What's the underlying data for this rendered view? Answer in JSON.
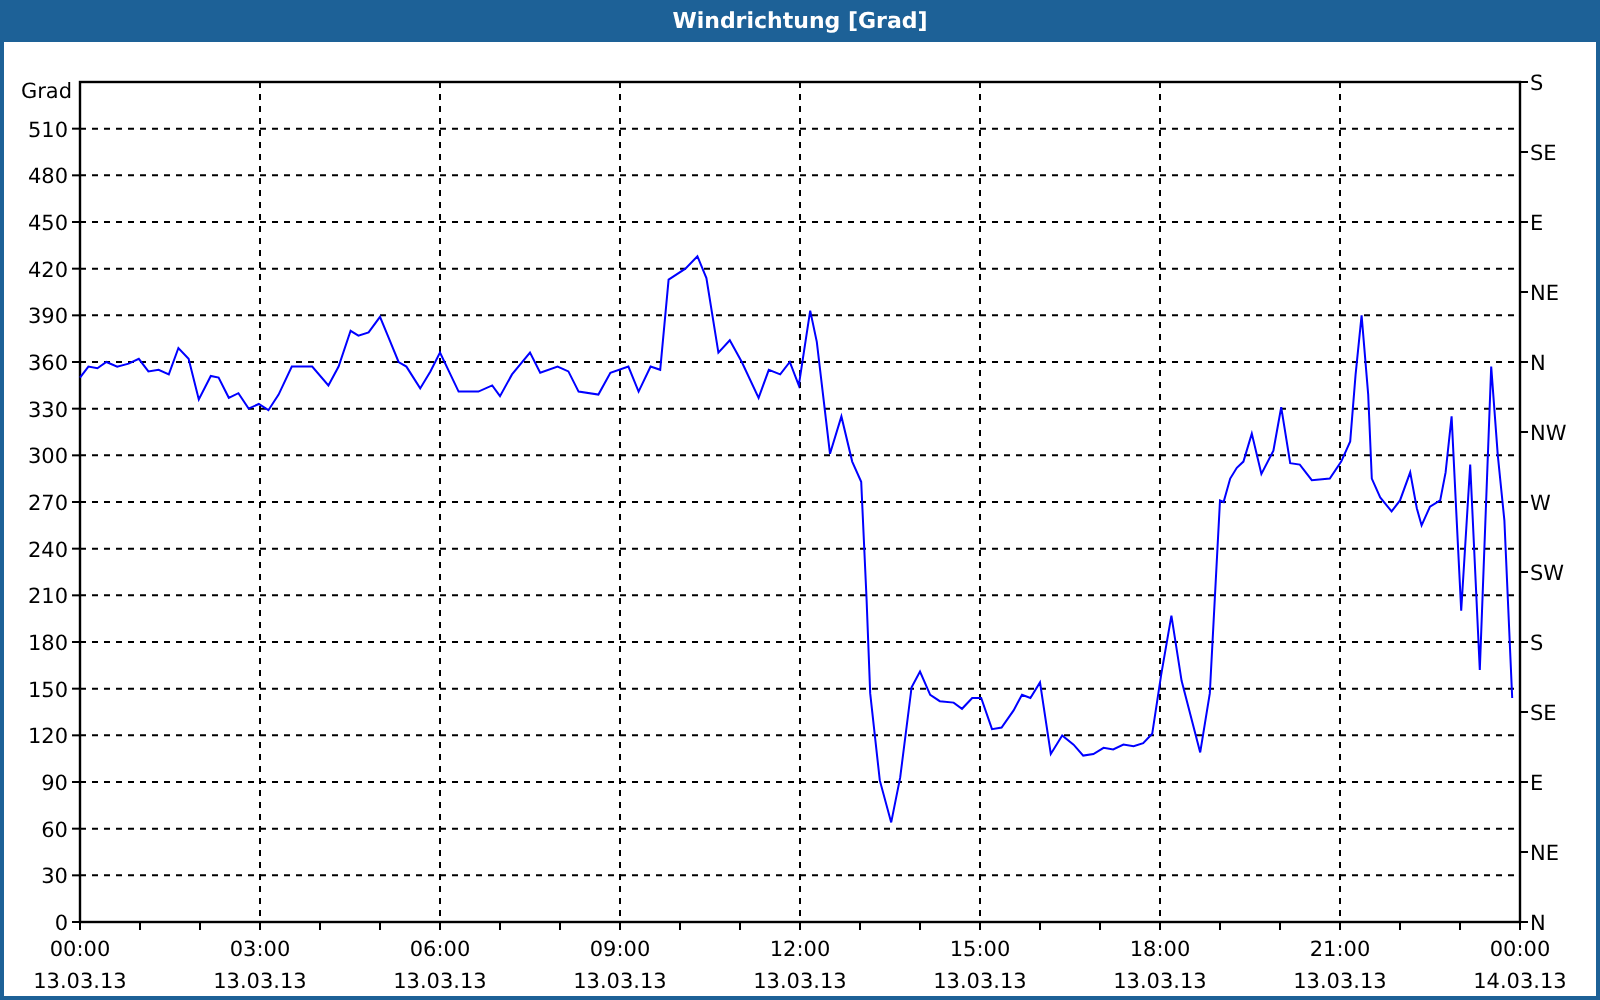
{
  "window": {
    "title": "Windrichtung [Grad]"
  },
  "chart": {
    "x_axis_dates": [
      "13.03.13",
      "13.03.13",
      "13.03.13",
      "13.03.13",
      "13.03.13",
      "13.03.13",
      "13.03.13",
      "13.03.13",
      "14.03.13"
    ],
    "right_axis_labels": [
      "S",
      "SE",
      "E",
      "NE",
      "N",
      "NW",
      "W",
      "SW",
      "S",
      "SE",
      "E",
      "NE",
      "N"
    ],
    "chart_data": {
      "type": "line",
      "grid": true,
      "ylabel": "Grad",
      "xlim": [
        0,
        24
      ],
      "ylim": [
        0,
        540
      ],
      "yticks": [
        0,
        30,
        60,
        90,
        120,
        150,
        180,
        210,
        240,
        270,
        300,
        330,
        360,
        390,
        420,
        450,
        480,
        510
      ],
      "xticks": [
        {
          "value": 0,
          "label": "00:00"
        },
        {
          "value": 3,
          "label": "03:00"
        },
        {
          "value": 6,
          "label": "06:00"
        },
        {
          "value": 9,
          "label": "09:00"
        },
        {
          "value": 12,
          "label": "12:00"
        },
        {
          "value": 15,
          "label": "15:00"
        },
        {
          "value": 18,
          "label": "18:00"
        },
        {
          "value": 21,
          "label": "21:00"
        },
        {
          "value": 24,
          "label": "00:00"
        }
      ],
      "x": [
        0,
        0.14,
        0.29,
        0.44,
        0.62,
        0.81,
        0.98,
        1.14,
        1.31,
        1.48,
        1.64,
        1.81,
        1.98,
        2.18,
        2.31,
        2.48,
        2.64,
        2.81,
        2.98,
        3.14,
        3.31,
        3.53,
        3.87,
        4.14,
        4.31,
        4.51,
        4.64,
        4.81,
        5.0,
        5.14,
        5.31,
        5.44,
        5.67,
        5.84,
        6.0,
        6.31,
        6.64,
        6.87,
        7.0,
        7.2,
        7.5,
        7.67,
        7.96,
        8.14,
        8.31,
        8.64,
        8.84,
        9.14,
        9.31,
        9.51,
        9.67,
        9.81,
        10.09,
        10.29,
        10.44,
        10.64,
        10.83,
        11.03,
        11.31,
        11.48,
        11.67,
        11.83,
        11.98,
        12.17,
        12.28,
        12.5,
        12.69,
        12.87,
        13.02,
        13.11,
        13.17,
        13.33,
        13.52,
        13.67,
        13.86,
        14.0,
        14.17,
        14.33,
        14.56,
        14.7,
        14.87,
        15.02,
        15.2,
        15.36,
        15.56,
        15.7,
        15.84,
        16.0,
        16.18,
        16.37,
        16.56,
        16.72,
        16.89,
        17.06,
        17.22,
        17.39,
        17.56,
        17.72,
        17.87,
        18.02,
        18.19,
        18.36,
        18.67,
        18.83,
        19.0,
        19.06,
        19.17,
        19.28,
        19.39,
        19.53,
        19.69,
        19.89,
        20.02,
        20.17,
        20.33,
        20.53,
        20.83,
        21.02,
        21.17,
        21.26,
        21.36,
        21.47,
        21.53,
        21.67,
        21.86,
        22.0,
        22.17,
        22.28,
        22.36,
        22.5,
        22.67,
        22.76,
        22.86,
        22.94,
        23.02,
        23.17,
        23.33,
        23.52,
        23.63,
        23.74,
        23.87
      ],
      "series": [
        {
          "color": "#0000ff",
          "values": [
            350,
            357,
            356,
            360,
            357,
            359,
            362,
            354,
            355,
            352,
            369,
            362,
            336,
            351,
            350,
            337,
            340,
            330,
            333,
            329,
            339,
            357,
            357,
            345,
            357,
            380,
            377,
            379,
            389,
            376,
            360,
            357,
            343,
            354,
            366,
            341,
            341,
            345,
            338,
            352,
            366,
            353,
            357,
            354,
            341,
            339,
            353,
            357,
            341,
            357,
            355,
            413,
            420,
            428,
            414,
            366,
            374,
            360,
            337,
            355,
            352,
            360,
            345,
            393,
            373,
            301,
            325,
            296,
            283,
            207,
            147,
            91,
            64,
            93,
            151,
            161,
            146,
            142,
            141,
            137,
            144,
            144,
            124,
            125,
            136,
            146,
            144,
            154,
            108,
            120,
            114,
            107,
            108,
            112,
            111,
            114,
            113,
            115,
            121,
            159,
            197,
            155,
            109,
            147,
            271,
            270,
            285,
            292,
            296,
            314,
            288,
            303,
            331,
            295,
            294,
            284,
            285,
            296,
            309,
            352,
            390,
            339,
            285,
            273,
            264,
            271,
            289,
            266,
            255,
            267,
            271,
            289,
            325,
            262,
            200,
            294,
            162,
            357,
            300,
            258,
            144
          ]
        }
      ]
    }
  }
}
